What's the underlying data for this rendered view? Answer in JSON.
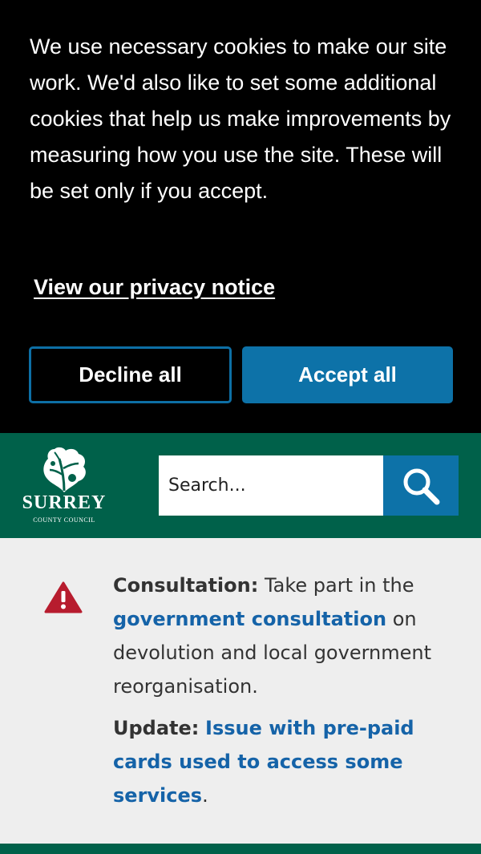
{
  "cookie_banner": {
    "message": "We use necessary cookies to make our site work. We'd also like to set some additional cookies that help us make improvements by measuring how you use the site. These will be set only if you accept.",
    "privacy_link": "View our privacy notice",
    "decline_label": "Decline all",
    "accept_label": "Accept all"
  },
  "header": {
    "logo_name": "SURREY",
    "logo_subtitle": "COUNTY COUNCIL",
    "search_placeholder": "Search...",
    "search_icon": "search-icon"
  },
  "alerts": [
    {
      "label": "Consultation:",
      "text_before": " Take part in the ",
      "link": "government consultation",
      "text_after": " on devolution and local government reorganisation."
    },
    {
      "label": "Update:",
      "text_before": " ",
      "link": "Issue with pre-paid cards used to access some services",
      "text_after": "."
    }
  ],
  "colors": {
    "banner_bg": "#000000",
    "header_green": "#00614a",
    "button_blue": "#0d72a8",
    "link_blue": "#1563a8",
    "alert_red": "#b71c2e",
    "alert_bg": "#eeeeee"
  }
}
